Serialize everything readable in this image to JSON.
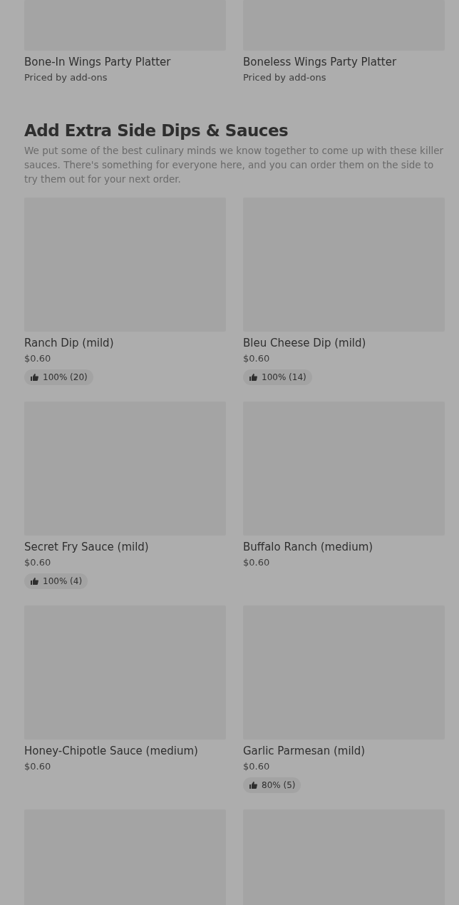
{
  "top_items": [
    {
      "title": "Bone-In Wings Party Platter",
      "subtitle": "Priced by add-ons"
    },
    {
      "title": "Boneless Wings Party Platter",
      "subtitle": "Priced by add-ons"
    }
  ],
  "section": {
    "title": "Add Extra Side Dips & Sauces",
    "description": "We put some of the best culinary minds we know together to come up with these killer sauces. There's something for everyone here, and you can order them on the side to try them out for your next order.",
    "items": [
      {
        "kind": "dish",
        "title": "Ranch Dip (mild)",
        "price": "$0.60",
        "rating": "100% (20)"
      },
      {
        "kind": "dish",
        "title": "Bleu Cheese Dip (mild)",
        "price": "$0.60",
        "rating": "100% (14)"
      },
      {
        "kind": "dish",
        "title": "Secret Fry Sauce (mild)",
        "price": "$0.60",
        "rating": "100% (4)"
      },
      {
        "kind": "dish",
        "title": "Buffalo Ranch (medium)",
        "price": "$0.60"
      },
      {
        "kind": "dish",
        "title": "Honey-Chipotle Sauce (medium)",
        "price": "$0.60"
      },
      {
        "kind": "dish",
        "title": "Garlic Parmesan (mild)",
        "price": "$0.60",
        "rating": "80% (5)"
      },
      {
        "kind": "image_only"
      },
      {
        "kind": "image_only"
      }
    ]
  }
}
